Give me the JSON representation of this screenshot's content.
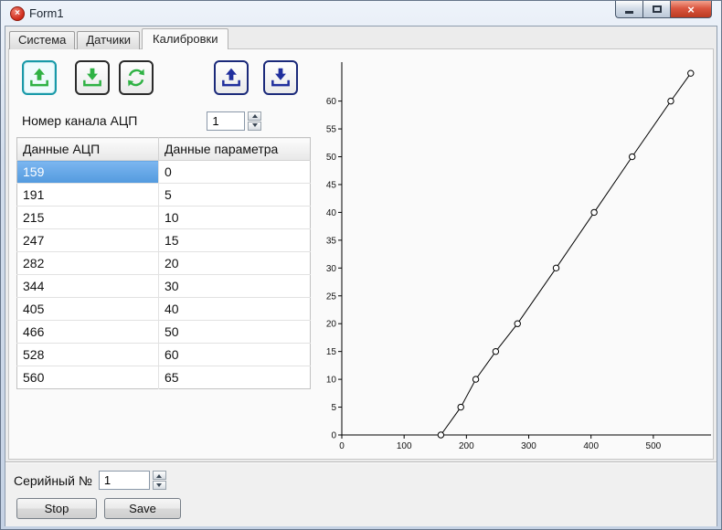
{
  "window": {
    "title": "Form1"
  },
  "tabs": {
    "system": "Система",
    "sensors": "Датчики",
    "calibrations": "Калибровки"
  },
  "toolbar": {
    "icons": [
      "upload-green-icon",
      "download-green-icon",
      "refresh-green-icon",
      "upload-blue-icon",
      "download-blue-icon"
    ]
  },
  "channel": {
    "label": "Номер канала АЦП",
    "value": "1"
  },
  "table": {
    "headers": [
      "Данные АЦП",
      "Данные параметра"
    ],
    "rows": [
      [
        "159",
        "0"
      ],
      [
        "191",
        "5"
      ],
      [
        "215",
        "10"
      ],
      [
        "247",
        "15"
      ],
      [
        "282",
        "20"
      ],
      [
        "344",
        "30"
      ],
      [
        "405",
        "40"
      ],
      [
        "466",
        "50"
      ],
      [
        "528",
        "60"
      ],
      [
        "560",
        "65"
      ]
    ],
    "selected": {
      "row": 0,
      "col": 0
    }
  },
  "chart_data": {
    "type": "line",
    "title": "",
    "xlabel": "",
    "ylabel": "",
    "x": [
      159,
      191,
      215,
      247,
      282,
      344,
      405,
      466,
      528,
      560
    ],
    "y": [
      0,
      5,
      10,
      15,
      20,
      30,
      40,
      50,
      60,
      65
    ],
    "xlim": [
      0,
      575
    ],
    "ylim": [
      0,
      67
    ],
    "xticks": [
      0,
      100,
      200,
      300,
      400,
      500
    ],
    "yticks": [
      0,
      5,
      10,
      15,
      20,
      25,
      30,
      35,
      40,
      45,
      50,
      55,
      60
    ],
    "grid": false,
    "legend": false,
    "marker": "open-circle",
    "line_color": "#000000"
  },
  "footer": {
    "serial_label": "Серийный №",
    "serial_value": "1",
    "stop_label": "Stop",
    "save_label": "Save"
  },
  "colors": {
    "selection": "#62a6e6",
    "accent_green": "#2fb244",
    "accent_blue": "#202f9d",
    "close_red": "#c9442c"
  }
}
